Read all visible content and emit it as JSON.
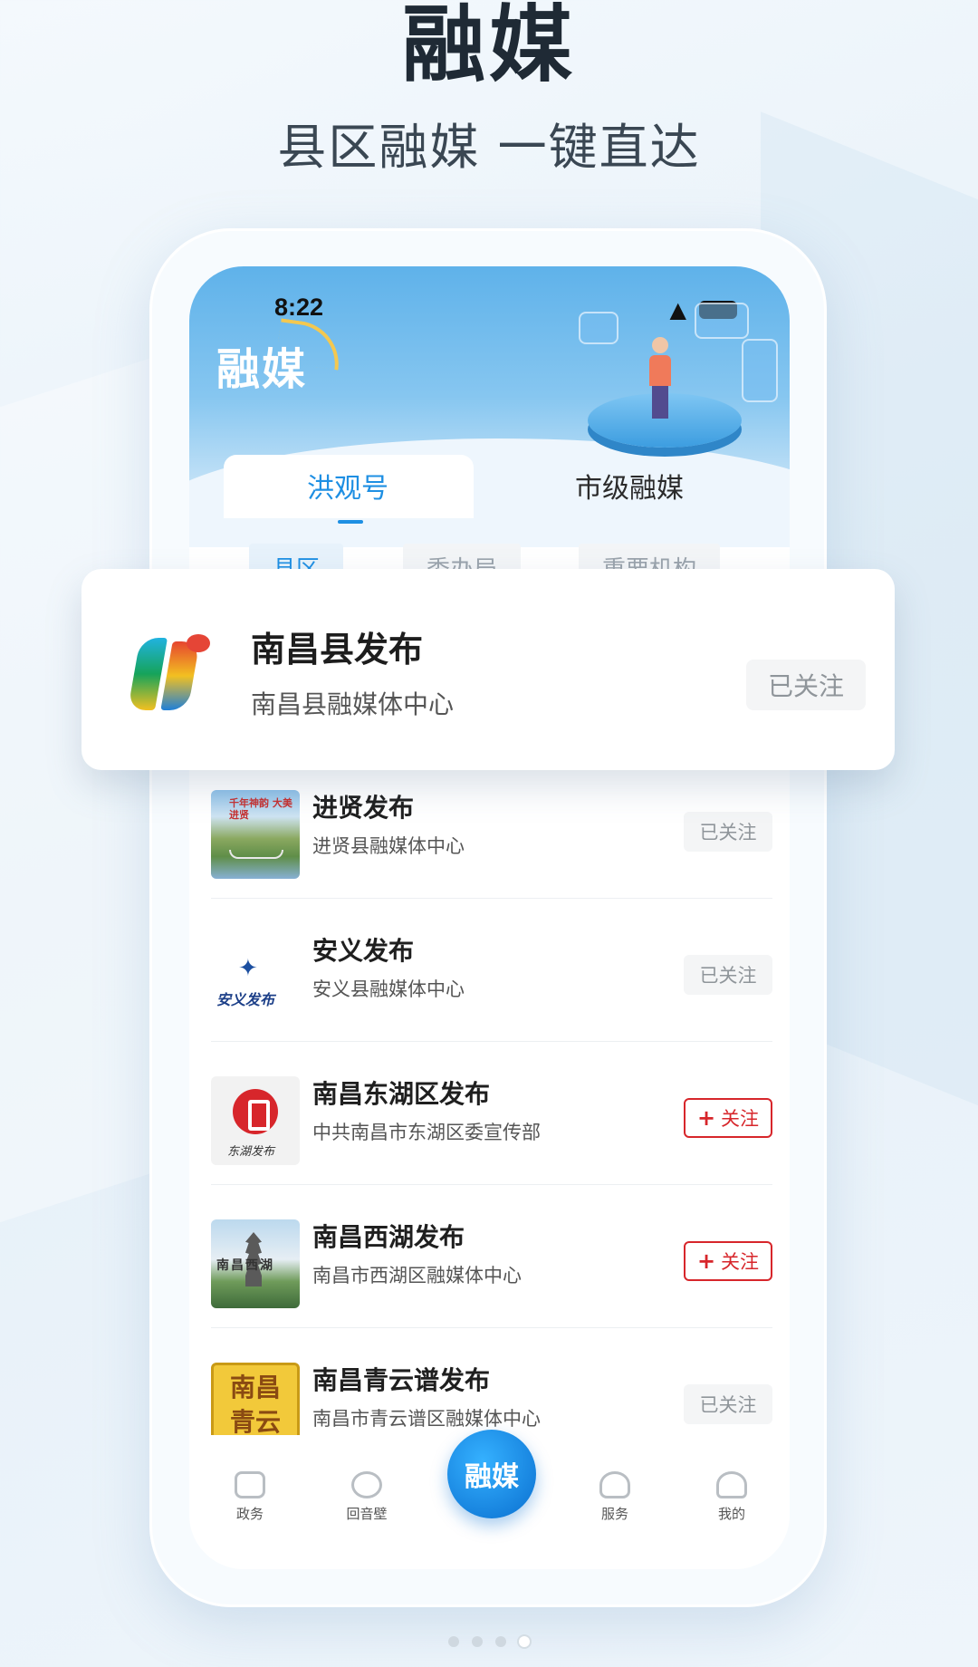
{
  "promo": {
    "title": "融媒",
    "subtitle": "县区融媒 一键直达"
  },
  "status_bar": {
    "time": "8:22",
    "icons": [
      "wifi-icon",
      "battery-icon"
    ]
  },
  "app": {
    "logo_text": "融媒"
  },
  "top_tabs": [
    {
      "label": "洪观号",
      "active": true
    },
    {
      "label": "市级融媒",
      "active": false
    }
  ],
  "sub_tabs": [
    {
      "label": "县区",
      "active": true
    },
    {
      "label": "委办局",
      "active": false
    },
    {
      "label": "重要机构",
      "active": false
    }
  ],
  "featured": {
    "name": "南昌县发布",
    "desc": "南昌县融媒体中心",
    "button": "已关注"
  },
  "list": [
    {
      "name": "进贤发布",
      "desc": "进贤县融媒体中心",
      "button": "已关注",
      "followed": true,
      "thumb_text": "千年神韵 大美进贤"
    },
    {
      "name": "安义发布",
      "desc": "安义县融媒体中心",
      "button": "已关注",
      "followed": true,
      "thumb_text": "安义发布"
    },
    {
      "name": "南昌东湖区发布",
      "desc": "中共南昌市东湖区委宣传部",
      "button": "关注",
      "followed": false,
      "thumb_text": "东湖发布"
    },
    {
      "name": "南昌西湖发布",
      "desc": "南昌市西湖区融媒体中心",
      "button": "关注",
      "followed": false,
      "thumb_text": "南昌西湖"
    },
    {
      "name": "南昌青云谱发布",
      "desc": "南昌市青云谱区融媒体中心",
      "button": "已关注",
      "followed": true,
      "thumb_text": "南昌青云谱"
    }
  ],
  "tabbar": {
    "items": [
      {
        "label": "政务",
        "icon": "government-icon"
      },
      {
        "label": "回音壁",
        "icon": "planet-icon"
      },
      {
        "label": "服务",
        "icon": "heart-icon"
      },
      {
        "label": "我的",
        "icon": "user-icon"
      }
    ],
    "center_label": "融媒"
  },
  "pager": {
    "count": 4,
    "active_index": 3
  },
  "colors": {
    "accent_blue": "#1e8fe3",
    "follow_red": "#d7262b"
  }
}
